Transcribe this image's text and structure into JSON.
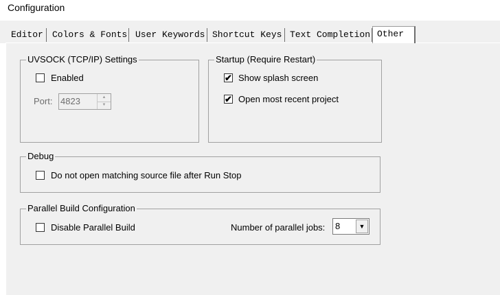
{
  "window": {
    "title": "Configuration"
  },
  "tabs": [
    {
      "label": "Editor"
    },
    {
      "label": "Colors & Fonts"
    },
    {
      "label": "User Keywords"
    },
    {
      "label": "Shortcut Keys"
    },
    {
      "label": "Text Completion"
    },
    {
      "label": "Other",
      "active": true
    }
  ],
  "uvsock": {
    "title": "UVSOCK (TCP/IP) Settings",
    "enabled_label": "Enabled",
    "enabled_checked": false,
    "port_label": "Port:",
    "port_value": "4823"
  },
  "startup": {
    "title": "Startup (Require Restart)",
    "splash_label": "Show splash screen",
    "splash_checked": true,
    "recent_label": "Open most recent project",
    "recent_checked": true
  },
  "debug": {
    "title": "Debug",
    "no_open_label": "Do not open matching source file after Run Stop",
    "no_open_checked": false
  },
  "parallel": {
    "title": "Parallel Build Configuration",
    "disable_label": "Disable Parallel Build",
    "disable_checked": false,
    "jobs_label": "Number of parallel jobs:",
    "jobs_value": "8"
  },
  "icons": {
    "check_mark": "✔",
    "arrow_up": "▲",
    "arrow_down": "▼"
  }
}
